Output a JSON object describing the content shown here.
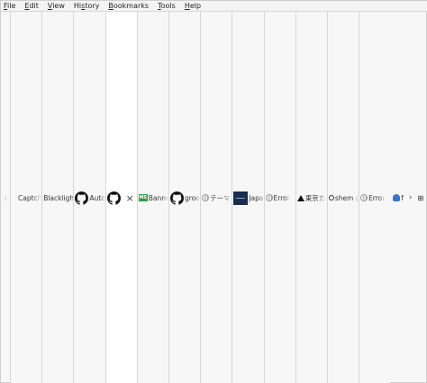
{
  "menubar": {
    "items": [
      {
        "mnemonic": "F",
        "rest": "ile"
      },
      {
        "mnemonic": "E",
        "rest": "dit"
      },
      {
        "mnemonic": "V",
        "rest": "iew"
      },
      {
        "mnemonic": "",
        "pre": "Hi",
        "mnemonic2": "s",
        "rest": "tory"
      },
      {
        "mnemonic": "B",
        "rest": "ookmarks"
      },
      {
        "mnemonic": "T",
        "rest": "ools"
      },
      {
        "mnemonic": "H",
        "rest": "elp"
      }
    ]
  },
  "tabs": [
    {
      "label": "Captcha",
      "icon": "none"
    },
    {
      "label": "Blacklight",
      "icon": "none"
    },
    {
      "label": "Auto",
      "icon": "github-icon"
    },
    {
      "label": "",
      "icon": "github-icon",
      "close": "×"
    },
    {
      "label": "Banner",
      "icon": "ms-icon",
      "icon_text": "MS"
    },
    {
      "label": "groot",
      "icon": "github-icon"
    },
    {
      "label": "テーマ",
      "icon": "globe-icon"
    },
    {
      "label": "Japan",
      "icon": "thumb-icon"
    },
    {
      "label": "Error",
      "icon": "globe-icon"
    },
    {
      "label": "東京カ",
      "icon": "warn-icon"
    },
    {
      "label": "shem p",
      "icon": "search-g-icon"
    },
    {
      "label": "Error",
      "icon": "globe-icon"
    },
    {
      "label": "f",
      "icon": "blue-icon"
    }
  ],
  "controls": {
    "scroll_left": "‹",
    "scroll_right": "›",
    "list_tabs": "⊞"
  }
}
